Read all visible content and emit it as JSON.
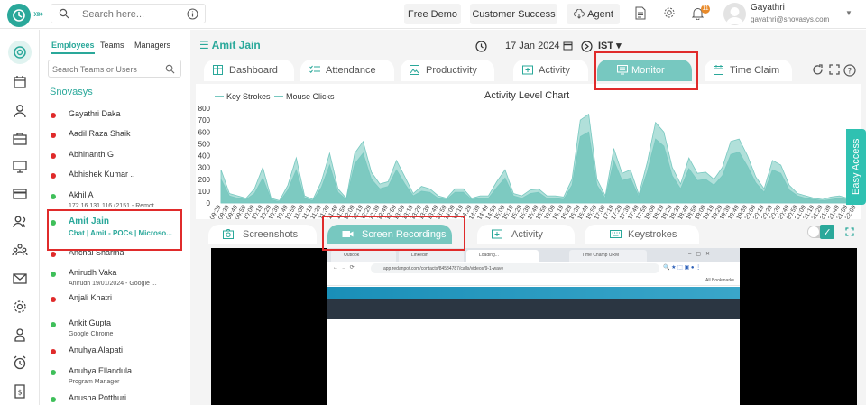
{
  "header": {
    "search_placeholder": "Search here...",
    "buttons": [
      "Free Demo",
      "Customer Success",
      "Agent"
    ],
    "notification_count": "11",
    "user_name": "Gayathri",
    "user_email": "gayathri@snovasys.com"
  },
  "employee_panel": {
    "tabs": [
      "Employees",
      "Teams",
      "Managers"
    ],
    "search_placeholder": "Search Teams or Users",
    "org": "Snovasys",
    "employees": [
      {
        "name": "Gayathri Daka",
        "status": "offline",
        "sub": ""
      },
      {
        "name": "Aadil Raza Shaik",
        "status": "offline",
        "sub": ""
      },
      {
        "name": "Abhinanth G",
        "status": "offline",
        "sub": ""
      },
      {
        "name": "Abhishek Kumar ..",
        "status": "offline",
        "sub": ""
      },
      {
        "name": "Akhil A",
        "status": "online",
        "sub": "172.16.131.116 (2151 - Remot..."
      },
      {
        "name": "Amit Jain",
        "status": "online",
        "sub": "Chat | Amit - POCs | Microso..."
      },
      {
        "name": "Anchal Sharma",
        "status": "offline",
        "sub": ""
      },
      {
        "name": "Anirudh Vaka",
        "status": "online",
        "sub": "Anirudh 19/01/2024 - Google ..."
      },
      {
        "name": "Anjali Khatri",
        "status": "offline",
        "sub": ""
      },
      {
        "name": "Ankit Gupta",
        "status": "online",
        "sub": "Google Chrome"
      },
      {
        "name": "Anuhya Alapati",
        "status": "offline",
        "sub": ""
      },
      {
        "name": "Anuhya Ellandula",
        "status": "online",
        "sub": "Program Manager"
      },
      {
        "name": "Anusha Potthuri",
        "status": "online",
        "sub": ""
      }
    ]
  },
  "main": {
    "selected_employee": "Amit Jain",
    "date": "17 Jan 2024",
    "timezone": "IST",
    "tabs": [
      "Dashboard",
      "Attendance",
      "Productivity",
      "Activity",
      "Monitor",
      "Time Claim"
    ],
    "active_tab": "Monitor",
    "sub_tabs": [
      "Screenshots",
      "Screen Recordings",
      "Activity",
      "Keystrokes"
    ],
    "active_sub_tab": "Screen Recordings"
  },
  "recording": {
    "browser_tabs": [
      "Outlook",
      "Linkedin",
      "Loading...",
      "Time Champ URM"
    ],
    "url": "app.redanpot.com/contacts/84584787/calls/videos/9-1-wave",
    "bookmarks": "All Bookmarks"
  },
  "easy_access": "Easy Access",
  "colors": {
    "accent": "#2aa89a",
    "tab_active": "#77c8c0",
    "highlight": "#e02b2b",
    "series": "#77c8c0"
  },
  "chart_data": {
    "type": "area",
    "title": "Activity Level Chart",
    "legend": [
      "Key Strokes",
      "Mouse Clicks"
    ],
    "ylim": [
      0,
      800
    ],
    "yticks": [
      "800",
      "700",
      "600",
      "500",
      "400",
      "300",
      "200",
      "100",
      "0"
    ],
    "x": [
      "09:29",
      "09:39",
      "09:49",
      "09:59",
      "10:09",
      "10:19",
      "10:29",
      "10:39",
      "10:49",
      "10:59",
      "11:09",
      "11:19",
      "11:29",
      "11:39",
      "11:49",
      "11:59",
      "12:09",
      "12:19",
      "12:29",
      "12:39",
      "12:49",
      "12:59",
      "13:09",
      "13:19",
      "13:29",
      "13:39",
      "13:49",
      "13:59",
      "14:09",
      "14:19",
      "14:29",
      "14:39",
      "14:49",
      "14:59",
      "15:09",
      "15:19",
      "15:29",
      "15:39",
      "15:49",
      "15:59",
      "16:09",
      "16:19",
      "16:29",
      "16:39",
      "16:49",
      "16:59",
      "17:09",
      "17:19",
      "17:29",
      "17:39",
      "17:49",
      "17:59",
      "18:09",
      "18:19",
      "18:29",
      "18:39",
      "18:49",
      "18:59",
      "19:09",
      "19:19",
      "19:29",
      "19:39",
      "19:49",
      "19:59",
      "20:09",
      "20:19",
      "20:29",
      "20:39",
      "20:49",
      "20:59",
      "21:09",
      "21:19",
      "21:29",
      "21:39",
      "21:49",
      "21:59",
      "22:09"
    ],
    "series": [
      {
        "name": "Key Strokes",
        "values": [
          280,
          80,
          60,
          40,
          120,
          300,
          40,
          20,
          150,
          380,
          60,
          30,
          180,
          420,
          120,
          40,
          420,
          520,
          260,
          160,
          180,
          360,
          220,
          80,
          140,
          120,
          60,
          40,
          120,
          120,
          40,
          60,
          60,
          180,
          280,
          80,
          60,
          110,
          120,
          60,
          60,
          50,
          200,
          700,
          750,
          200,
          60,
          460,
          250,
          280,
          70,
          340,
          680,
          600,
          300,
          160,
          380,
          250,
          260,
          200,
          300,
          520,
          540,
          400,
          220,
          120,
          360,
          320,
          150,
          80,
          60,
          40,
          30,
          50,
          60,
          40,
          90
        ]
      },
      {
        "name": "Mouse Clicks",
        "values": [
          200,
          60,
          40,
          30,
          80,
          210,
          30,
          10,
          110,
          280,
          40,
          20,
          130,
          320,
          90,
          30,
          330,
          420,
          200,
          120,
          140,
          280,
          160,
          60,
          100,
          90,
          40,
          30,
          90,
          90,
          30,
          40,
          40,
          130,
          210,
          60,
          40,
          80,
          90,
          40,
          40,
          30,
          150,
          560,
          600,
          150,
          40,
          360,
          190,
          210,
          50,
          260,
          540,
          480,
          230,
          120,
          290,
          190,
          200,
          150,
          230,
          410,
          430,
          310,
          170,
          90,
          280,
          250,
          110,
          60,
          40,
          30,
          20,
          30,
          40,
          30,
          70
        ]
      }
    ]
  }
}
